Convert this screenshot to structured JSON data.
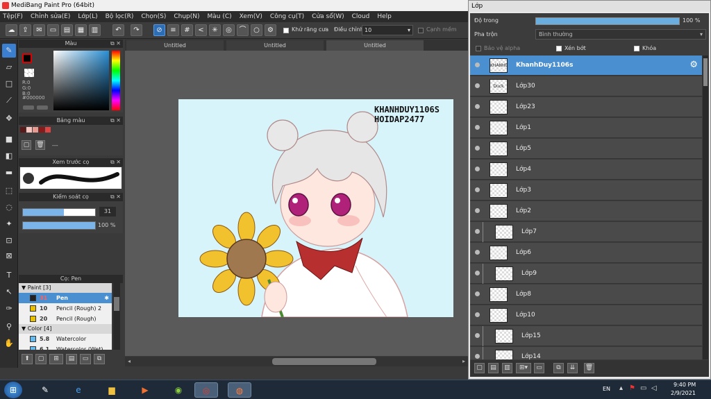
{
  "window": {
    "title": "MediBang Paint Pro (64bit)"
  },
  "menu": [
    "Tệp(F)",
    "Chỉnh sửa(E)",
    "Lớp(L)",
    "Bộ lọc(R)",
    "Chọn(S)",
    "Chụp(N)",
    "Màu (C)",
    "Xem(V)",
    "Công cụ(T)",
    "Cửa sổ(W)",
    "Cloud",
    "Help"
  ],
  "toolbar": {
    "antialias_label": "Khử răng cưa",
    "correction_label": "Điều chỉnh",
    "correction_value": "10",
    "snap_label": "Cạnh mềm"
  },
  "color_panel": {
    "title": "Màu",
    "r": "R:0",
    "g": "G:0",
    "b": "B:0",
    "hex": "#000000"
  },
  "palette_panel": {
    "title": "Bảng màu",
    "name": "---"
  },
  "brush_preview_panel": {
    "title": "Xem trước cọ"
  },
  "brush_control_panel": {
    "title": "Kiểm soát cọ",
    "size": "31",
    "opacity": "100 %"
  },
  "brush_list_panel": {
    "title": "Cọ: Pen",
    "groups": [
      {
        "name": "Paint [3]",
        "items": [
          {
            "size": "31",
            "name": "Pen",
            "color": "#222222",
            "selected": true
          },
          {
            "size": "10",
            "name": "Pencil (Rough) 2",
            "color": "#e8c000",
            "selected": false
          },
          {
            "size": "20",
            "name": "Pencil (Rough)",
            "color": "#e8c000",
            "selected": false
          }
        ]
      },
      {
        "name": "Color [4]",
        "items": [
          {
            "size": "5.8",
            "name": "Watercolor",
            "color": "#66bbee",
            "selected": false
          },
          {
            "size": "6.1",
            "name": "Watercolor (Wet)",
            "color": "#66bbee",
            "selected": false
          }
        ]
      }
    ]
  },
  "tabs": [
    "Untitled",
    "Untitled",
    "Untitled"
  ],
  "canvas": {
    "watermark_line1": "KHANHDUY1106S",
    "watermark_line2": "HOIDAP2477",
    "bg": "#d8f4fb"
  },
  "layer_panel": {
    "title": "Lớp",
    "opacity_label": "Độ trong",
    "opacity_value": "100 %",
    "blend_label": "Pha trộn",
    "blend_value": "Bình thường",
    "protect_alpha": "Bảo vệ alpha",
    "clipping": "Xén bớt",
    "lock": "Khóa",
    "layers": [
      {
        "name": "KhanhDuy1106s",
        "selected": true,
        "indent": false,
        "thumb_text": "KHANHDUY"
      },
      {
        "name": "Lớp30",
        "selected": false,
        "indent": false,
        "thumb_text": "Duck"
      },
      {
        "name": "Lớp23",
        "selected": false,
        "indent": false,
        "thumb_text": ""
      },
      {
        "name": "Lớp1",
        "selected": false,
        "indent": false,
        "thumb_text": ""
      },
      {
        "name": "Lớp5",
        "selected": false,
        "indent": false,
        "thumb_text": ""
      },
      {
        "name": "Lớp4",
        "selected": false,
        "indent": false,
        "thumb_text": ""
      },
      {
        "name": "Lớp3",
        "selected": false,
        "indent": false,
        "thumb_text": ""
      },
      {
        "name": "Lớp2",
        "selected": false,
        "indent": false,
        "thumb_text": ""
      },
      {
        "name": "Lớp7",
        "selected": false,
        "indent": true,
        "thumb_text": ""
      },
      {
        "name": "Lớp6",
        "selected": false,
        "indent": false,
        "thumb_text": ""
      },
      {
        "name": "Lớp9",
        "selected": false,
        "indent": true,
        "thumb_text": ""
      },
      {
        "name": "Lớp8",
        "selected": false,
        "indent": false,
        "thumb_text": ""
      },
      {
        "name": "Lớp10",
        "selected": false,
        "indent": false,
        "thumb_text": ""
      },
      {
        "name": "Lớp15",
        "selected": false,
        "indent": true,
        "thumb_text": ""
      },
      {
        "name": "Lớp14",
        "selected": false,
        "indent": true,
        "thumb_text": ""
      }
    ]
  },
  "taskbar": {
    "lang": "EN",
    "time": "9:40 PM",
    "date": "2/9/2021"
  }
}
